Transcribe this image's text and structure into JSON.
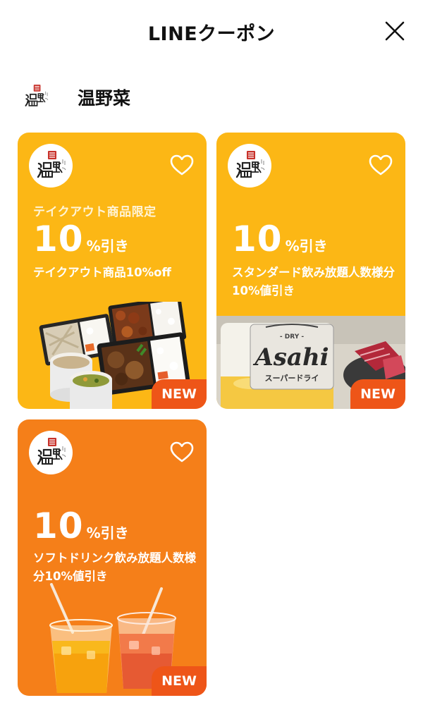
{
  "header": {
    "title": "LINEクーポン",
    "close_icon": "close-icon"
  },
  "shop": {
    "name": "温野菜",
    "logo_text": "温野菜"
  },
  "coupons": [
    {
      "subtitle": "テイクアウト商品限定",
      "discount_number": "10",
      "discount_unit": "%引き",
      "description": "テイクアウト商品10%off",
      "badge": "NEW",
      "photo": "takeout-bento-image",
      "color": "#fcb715"
    },
    {
      "subtitle": "",
      "discount_number": "10",
      "discount_unit": "%引き",
      "description": "スタンダード飲み放題人数様分10%値引き",
      "badge": "NEW",
      "photo": "asahi-beer-image",
      "photo_text": {
        "brand": "Asahi",
        "label": "DRY",
        "katakana": "スーパードライ"
      },
      "color": "#fcb715"
    },
    {
      "subtitle": "",
      "discount_number": "10",
      "discount_unit": "%引き",
      "description": "ソフトドリンク飲み放題人数様分10%値引き",
      "badge": "NEW",
      "photo": "soft-drinks-image",
      "color": "#f57f19"
    }
  ],
  "colors": {
    "yellow": "#fcb715",
    "orange": "#f57f19",
    "badge": "#ee5518"
  }
}
